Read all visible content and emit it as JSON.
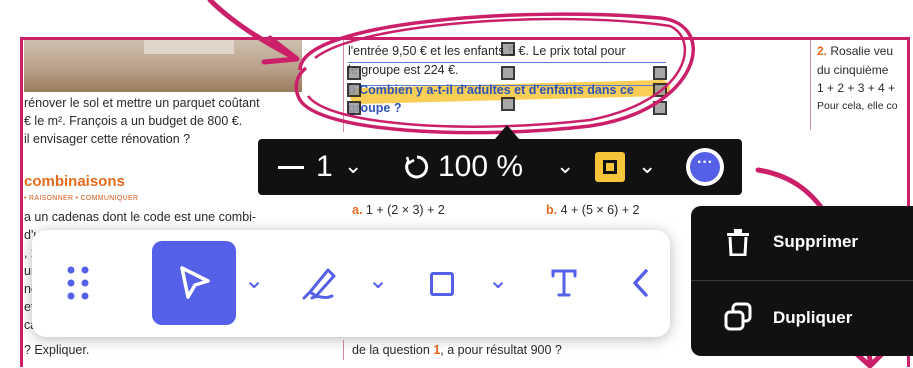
{
  "colors": {
    "accent": "#5560e8",
    "frame": "#cc1f6a",
    "orange": "#e66a1f",
    "highlight": "#f7c53a",
    "toolbar_dark": "#111111"
  },
  "textbook": {
    "left": {
      "lines": [
        "rénover le sol et mettre un parquet coûtant",
        "€ le m². François a un budget de 800 €.",
        "il envisager cette rénovation ?"
      ],
      "section_title": "combinaisons",
      "tags": "• RAISONNER • COMMUNIQUER",
      "lines2": [
        "a un cadenas dont le code est une combi-",
        "d'u",
        "",
        ", 2",
        "ur",
        "ne",
        "et",
        "ca"
      ],
      "last_line": "? Expliquer."
    },
    "middle": {
      "lines": [
        "l'entrée 9,50 € et les enfants 5 €. Le prix total pour",
        "le groupe est 224 €."
      ],
      "question": "b Combien y a-t-il d'adultes et d'enfants dans ce",
      "question_end": "groupe ?",
      "expr_a": "1 + (2 × 3) + 2",
      "expr_b": "4 + (5 × 6) + 2",
      "label_a": "a.",
      "label_b": "b.",
      "bottom_pre": "de la question ",
      "bottom_num": "1",
      "bottom_post": ", a pour résultat 900 ?"
    },
    "right": {
      "num": "2.",
      "line1": " Rosalie veu",
      "line2": "du cinquième",
      "line3": "1 + 2 + 3 + 4 +",
      "line4": "Pour cela, elle co"
    }
  },
  "dark_toolbar": {
    "stroke_icon": "line-weight-icon",
    "stroke_value": "1",
    "opacity_icon": "opacity-icon",
    "opacity_value": "100 %",
    "color_icon": "fill-color-swatch-icon",
    "more_icon": "more-options-icon"
  },
  "context_menu": {
    "delete_label": "Supprimer",
    "delete_icon": "trash-icon",
    "duplicate_label": "Dupliquer",
    "duplicate_icon": "duplicate-icon"
  },
  "drawing_toolbar": {
    "grip_icon": "drag-grip-icon",
    "select_icon": "pointer-select-icon",
    "pen_icon": "pen-icon",
    "shape_icon": "rectangle-shape-icon",
    "text_icon": "text-tool-icon",
    "collapse_icon": "chevron-left-icon"
  }
}
